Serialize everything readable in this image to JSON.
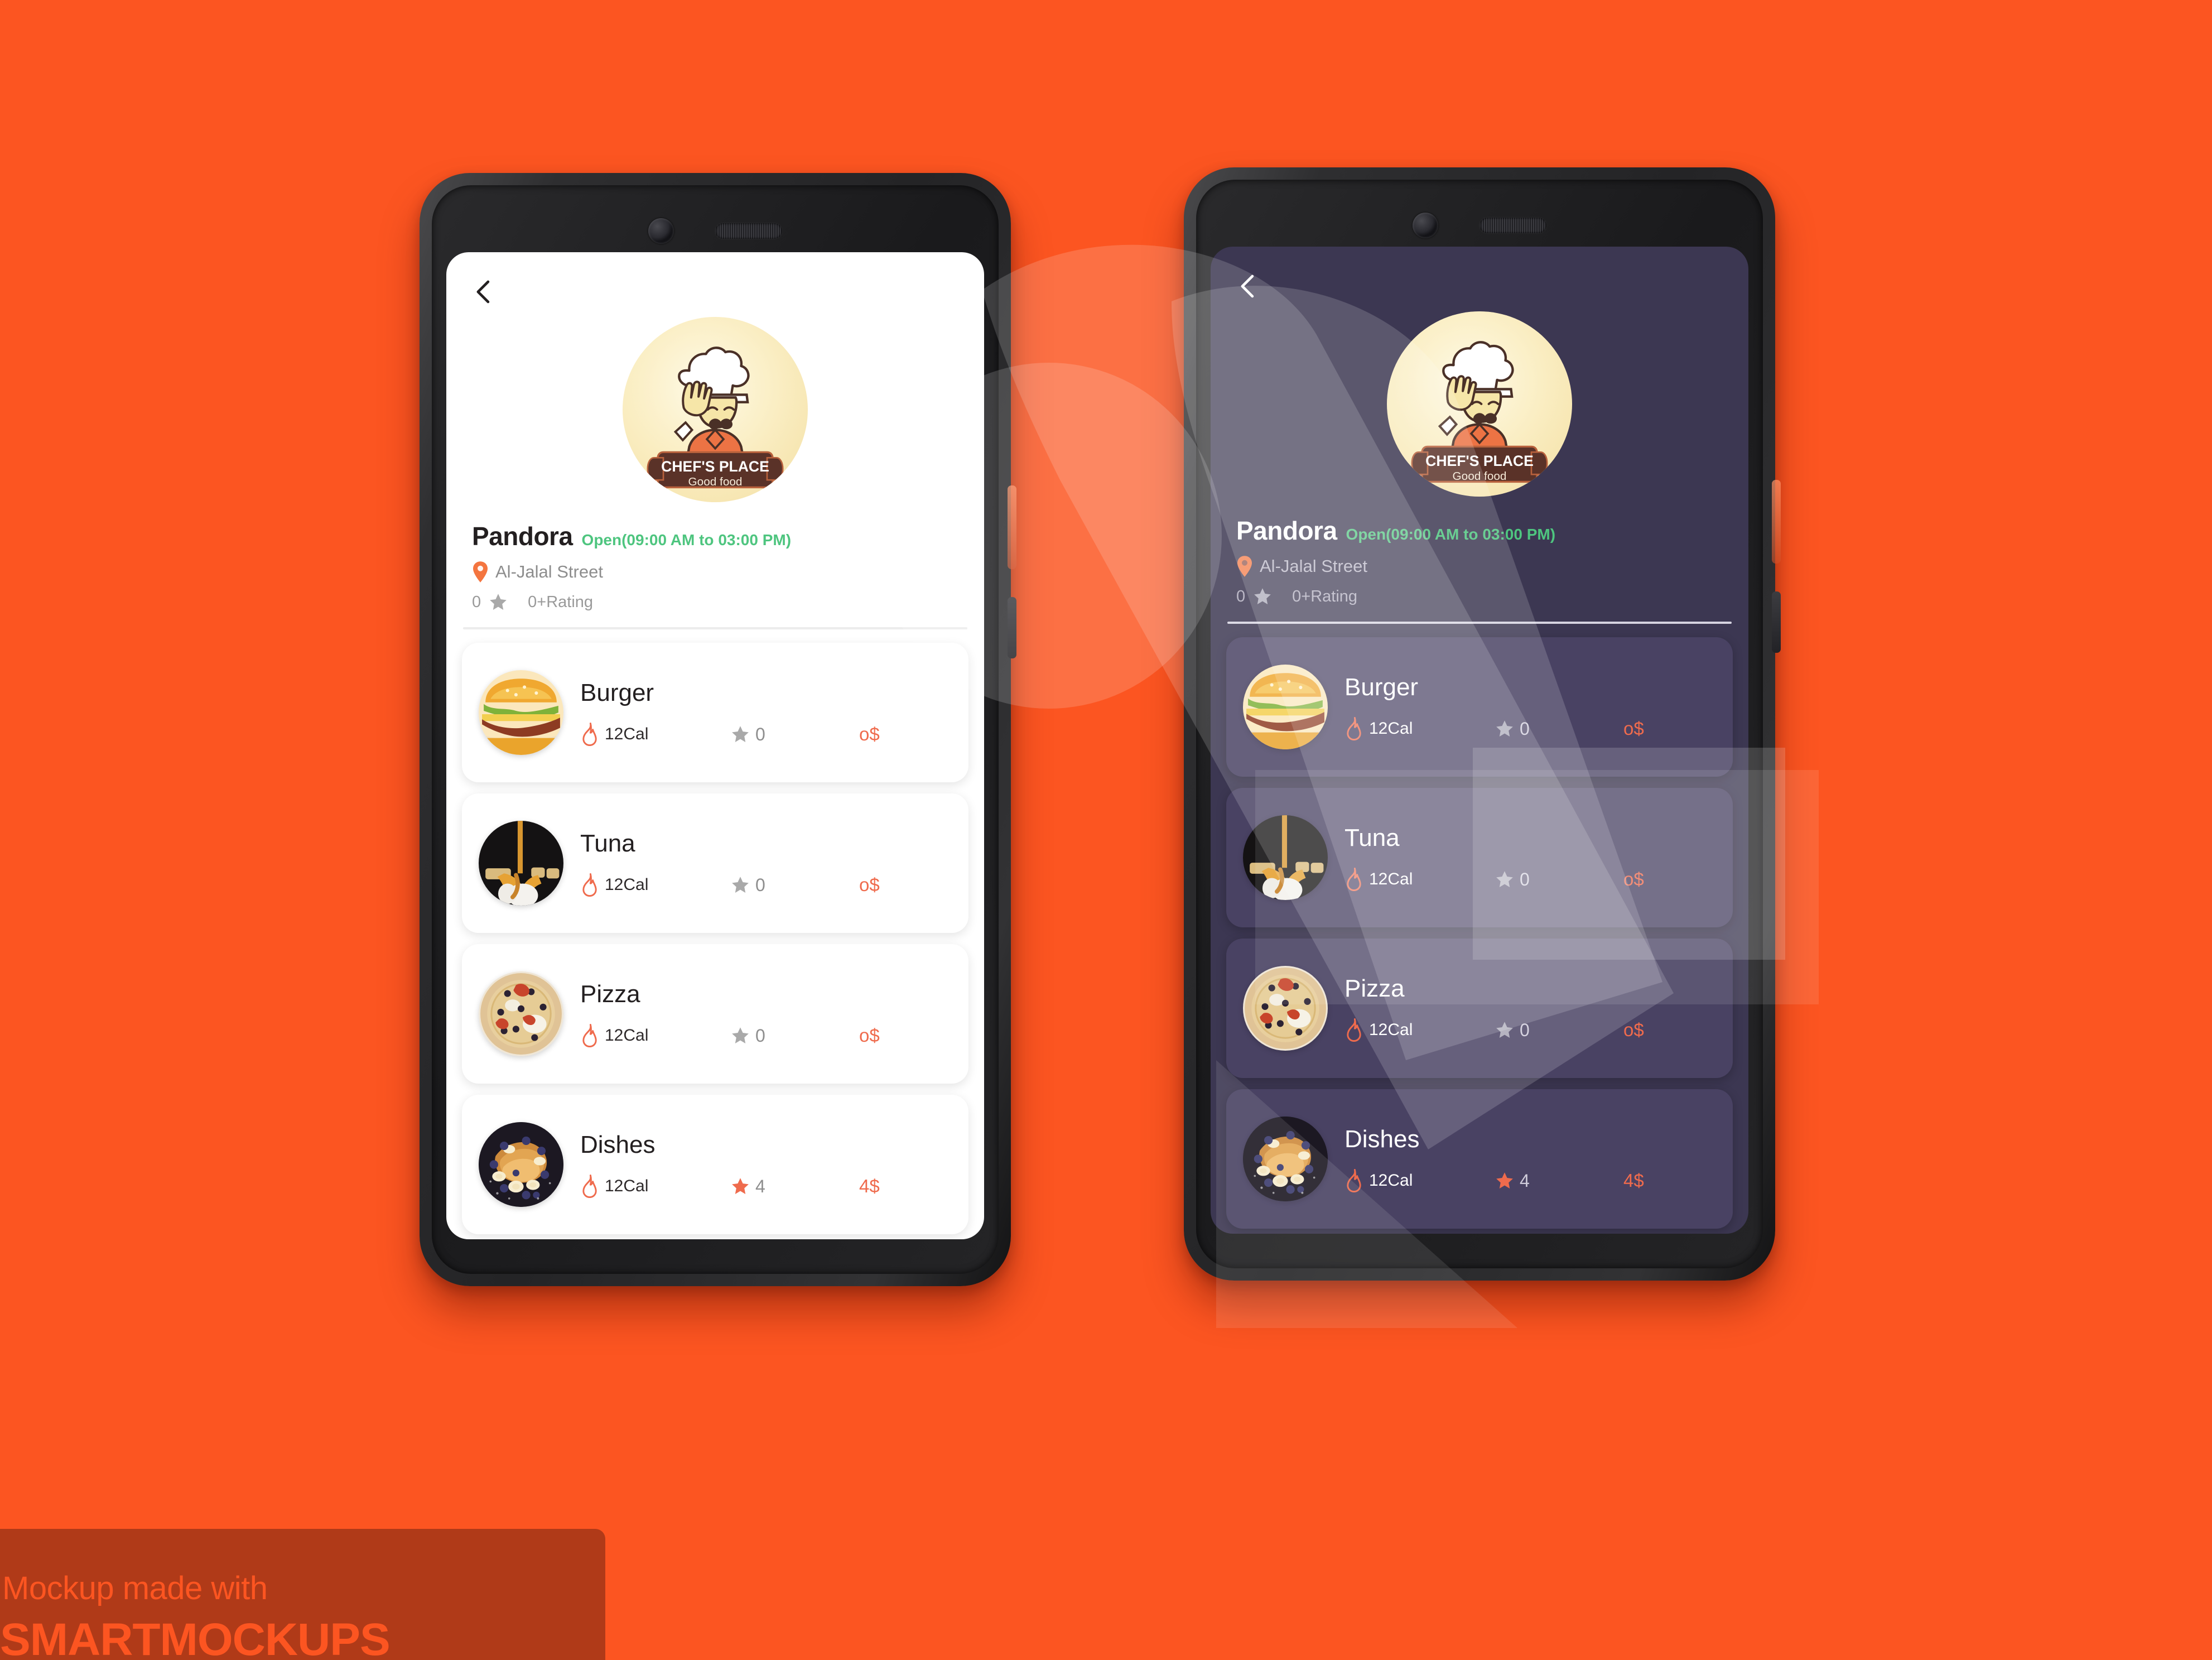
{
  "background_color": "#fc5521",
  "accent_color": "#ef6b4d",
  "open_color": "#4ec57f",
  "restaurant": {
    "name": "Pandora",
    "hours": "Open(09:00 AM to 03:00 PM)",
    "address": "Al-Jalal Street",
    "rating_value": "0",
    "rating_label": "0+Rating",
    "logo": {
      "brand": "CHEF'S PLACE",
      "tagline": "Good food"
    }
  },
  "icons": {
    "back": "back-chevron-icon",
    "pin": "location-pin-icon",
    "star": "star-icon",
    "flame": "flame-icon"
  },
  "menu_items": [
    {
      "name": "Burger",
      "calories": "12Cal",
      "rating": "0",
      "price": "o$",
      "rated": false,
      "image": "burger-thumbnail"
    },
    {
      "name": "Tuna",
      "calories": "12Cal",
      "rating": "0",
      "price": "o$",
      "rated": false,
      "image": "tuna-thumbnail"
    },
    {
      "name": "Pizza",
      "calories": "12Cal",
      "rating": "0",
      "price": "o$",
      "rated": false,
      "image": "pizza-thumbnail"
    },
    {
      "name": "Dishes",
      "calories": "12Cal",
      "rating": "4",
      "price": "4$",
      "rated": true,
      "image": "dishes-thumbnail"
    }
  ],
  "phones": [
    {
      "theme": "light",
      "label": "light-theme-phone"
    },
    {
      "theme": "dark",
      "label": "dark-theme-phone"
    }
  ],
  "watermark": {
    "line1": "Mockup made with",
    "line2": "SMARTMOCKUPS"
  }
}
